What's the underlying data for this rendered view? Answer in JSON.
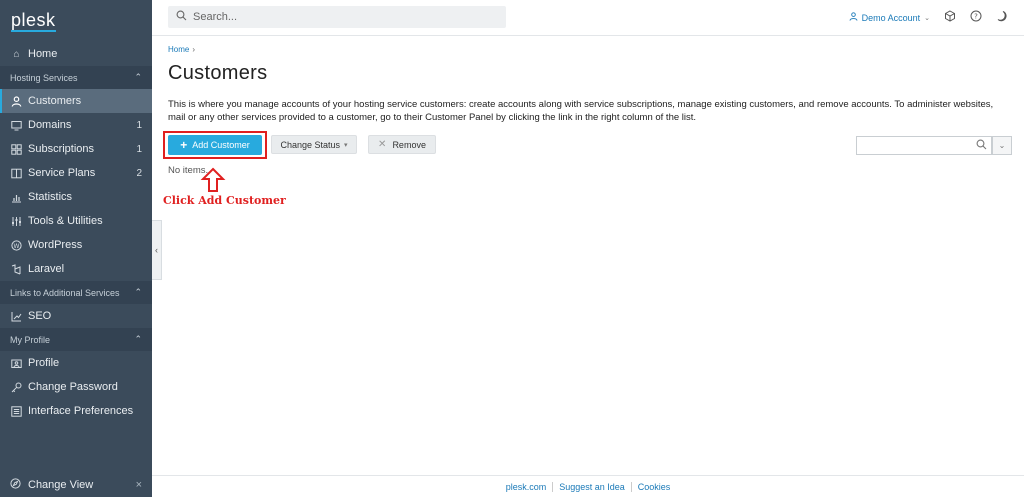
{
  "sidebar": {
    "logo": "plesk",
    "home": "Home",
    "group_hosting": "Hosting Services",
    "items_hosting": [
      {
        "label": "Customers",
        "count": "",
        "icon": "user-icon"
      },
      {
        "label": "Domains",
        "count": "1",
        "icon": "monitor-icon"
      },
      {
        "label": "Subscriptions",
        "count": "1",
        "icon": "grid-icon"
      },
      {
        "label": "Service Plans",
        "count": "2",
        "icon": "book-icon"
      },
      {
        "label": "Statistics",
        "count": "",
        "icon": "bar-chart-icon"
      },
      {
        "label": "Tools & Utilities",
        "count": "",
        "icon": "sliders-icon"
      },
      {
        "label": "WordPress",
        "count": "",
        "icon": "wordpress-icon"
      },
      {
        "label": "Laravel",
        "count": "",
        "icon": "laravel-icon"
      }
    ],
    "group_links": "Links to Additional Services",
    "seo": "SEO",
    "group_profile": "My Profile",
    "profile_items": [
      "Profile",
      "Change Password",
      "Interface Preferences"
    ],
    "change_view": "Change View",
    "accent": "#28aade",
    "background": "#3b4b5b"
  },
  "topbar": {
    "search_placeholder": "Search...",
    "account": "Demo Account"
  },
  "main": {
    "breadcrumb": "Home",
    "title": "Customers",
    "description": "This is where you manage accounts of your hosting service customers: create accounts along with service subscriptions, manage existing customers, and remove accounts. To administer websites, mail or any other services provided to a customer, go to their Customer Panel by clicking the link in the right column of the list.",
    "add_customer": "Add Customer",
    "change_status": "Change Status",
    "remove": "Remove",
    "no_items": "No items.",
    "annotation": "Click Add Customer",
    "annotation_color": "#e02020"
  },
  "footer": {
    "links": [
      "plesk.com",
      "Suggest an Idea",
      "Cookies"
    ]
  }
}
